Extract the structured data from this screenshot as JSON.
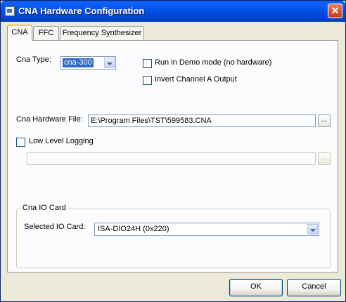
{
  "window": {
    "title": "CNA Hardware Configuration",
    "close_glyph": "✕"
  },
  "tabs": [
    {
      "label": "CNA",
      "active": true
    },
    {
      "label": "FFC",
      "active": false
    },
    {
      "label": "Frequency Synthesizer",
      "active": false
    }
  ],
  "cna_tab": {
    "cna_type": {
      "label": "Cna Type:",
      "value": "cna-300"
    },
    "demo_mode": {
      "label": "Run in Demo mode (no hardware)",
      "checked": false
    },
    "invert_channel": {
      "label": "Invert Channel A Output",
      "checked": false
    },
    "hardware_file": {
      "label": "Cna Hardware File:",
      "value": "E:\\Program Files\\TST\\599583.CNA",
      "browse_label": "..."
    },
    "low_level_logging": {
      "label": "Low Level Logging",
      "checked": false,
      "path_value": "",
      "browse_label": "..."
    },
    "io_card": {
      "group_title": "Cna IO Card",
      "label": "Selected IO Card:",
      "value": "ISA-DIO24H (0x220)"
    }
  },
  "buttons": {
    "ok": "OK",
    "cancel": "Cancel"
  },
  "colors": {
    "titlebar": "#0151e6",
    "dialog_bg": "#ece9d8",
    "tab_accent": "#ffc83c",
    "selection": "#316ac5"
  }
}
